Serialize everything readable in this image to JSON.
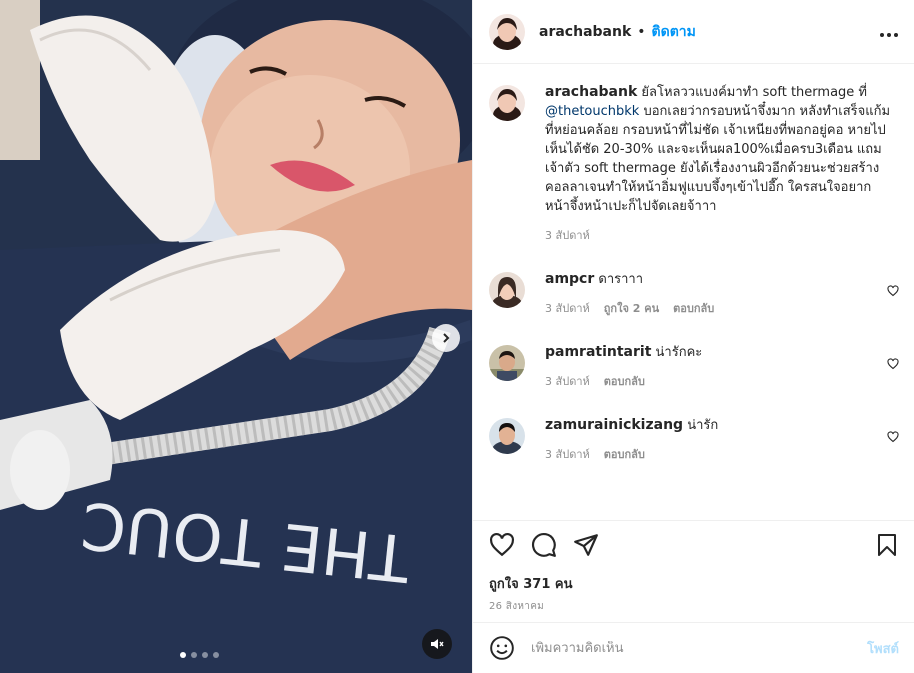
{
  "media": {
    "shirt_text": "THE TOUC",
    "carousel_dots": 4,
    "active_dot": 0
  },
  "post": {
    "username": "arachabank",
    "separator": "•",
    "follow_label": "ติดตาม",
    "more_label": "•••",
    "caption": {
      "username": "arachabank",
      "text_before_mention": " ยัลโหลววแบงค์มาทำ soft thermage ที่ ",
      "mention": "@thetouchbkk",
      "text_after_mention": " บอกเลยว่ากรอบหน้าจึ๋งมาก หลังทำเสร็จแก้มที่หย่อนคล้อย กรอบหน้าที่ไม่ชัด เจ้าเหนียงที่พอกอยู่คอ หายไปเห็นได้ชัด 20-30% และจะเห็นผล100%เมื่อครบ3เดือน แถมเจ้าตัว soft thermage ยังได้เรื่องงานผิวอีกด้วยนะช่วยสร้างคอลลาเจนทำให้หน้าอิ่มฟูแบบจึ้งๆเข้าไปอี๊ก ใครสนใจอยากหน้าจึ้งหน้าเปะก็ไปจัดเลยจ้าาา",
      "time": "3 สัปดาห์"
    },
    "comments": [
      {
        "username": "ampcr",
        "text": " ดาราาา",
        "time": "3 สัปดาห์",
        "likes": "ถูกใจ 2 คน",
        "reply": "ตอบกลับ"
      },
      {
        "username": "pamratintarit",
        "text": " น่ารักคะ",
        "time": "3 สัปดาห์",
        "likes": "",
        "reply": "ตอบกลับ"
      },
      {
        "username": "zamurainickizang",
        "text": " น่ารัก",
        "time": "3 สัปดาห์",
        "likes": "",
        "reply": "ตอบกลับ"
      }
    ],
    "likes_label": "ถูกใจ 371 คน",
    "date": "26 สิงหาคม",
    "add_comment_placeholder": "เพิ่มความคิดเห็น",
    "post_button": "โพสต์"
  },
  "icons": [
    "heart-icon",
    "comment-icon",
    "share-icon",
    "bookmark-icon",
    "emoji-icon",
    "mute-icon",
    "chevron-right-icon",
    "more-icon"
  ],
  "colors": {
    "follow": "#0095f6",
    "post_disabled": "#b2dffc",
    "muted_text": "#8e8e8e",
    "mention": "#00376b"
  }
}
